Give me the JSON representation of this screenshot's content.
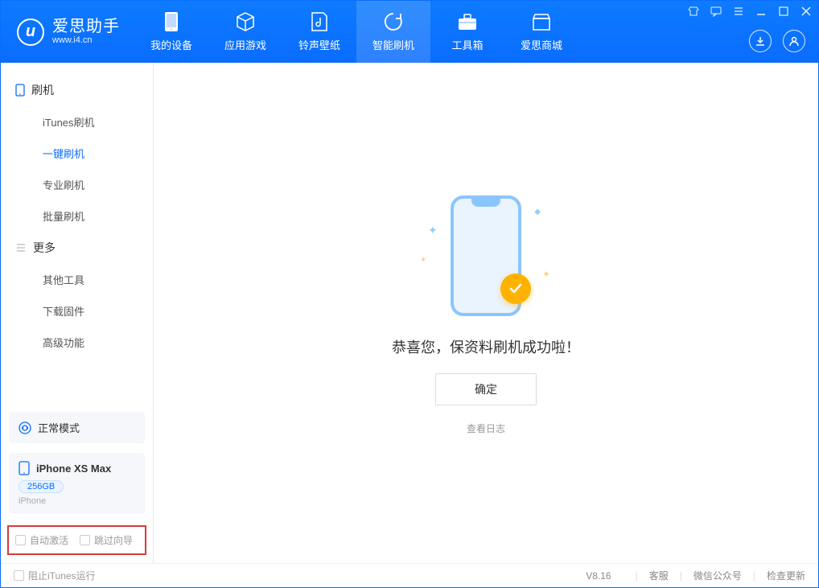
{
  "app": {
    "name_cn": "爱思助手",
    "name_en": "www.i4.cn"
  },
  "nav": {
    "tabs": [
      {
        "label": "我的设备"
      },
      {
        "label": "应用游戏"
      },
      {
        "label": "铃声壁纸"
      },
      {
        "label": "智能刷机"
      },
      {
        "label": "工具箱"
      },
      {
        "label": "爱思商城"
      }
    ]
  },
  "sidebar": {
    "group1_title": "刷机",
    "items1": [
      {
        "label": "iTunes刷机"
      },
      {
        "label": "一键刷机"
      },
      {
        "label": "专业刷机"
      },
      {
        "label": "批量刷机"
      }
    ],
    "group2_title": "更多",
    "items2": [
      {
        "label": "其他工具"
      },
      {
        "label": "下载固件"
      },
      {
        "label": "高级功能"
      }
    ],
    "mode_label": "正常模式",
    "device": {
      "name": "iPhone XS Max",
      "capacity": "256GB",
      "type": "iPhone"
    },
    "check_auto_activate": "自动激活",
    "check_skip_setup": "跳过向导"
  },
  "main": {
    "success_message": "恭喜您，保资料刷机成功啦！",
    "ok_button": "确定",
    "view_log": "查看日志"
  },
  "footer": {
    "block_itunes": "阻止iTunes运行",
    "version": "V8.16",
    "link_service": "客服",
    "link_wechat": "微信公众号",
    "link_update": "检查更新"
  }
}
